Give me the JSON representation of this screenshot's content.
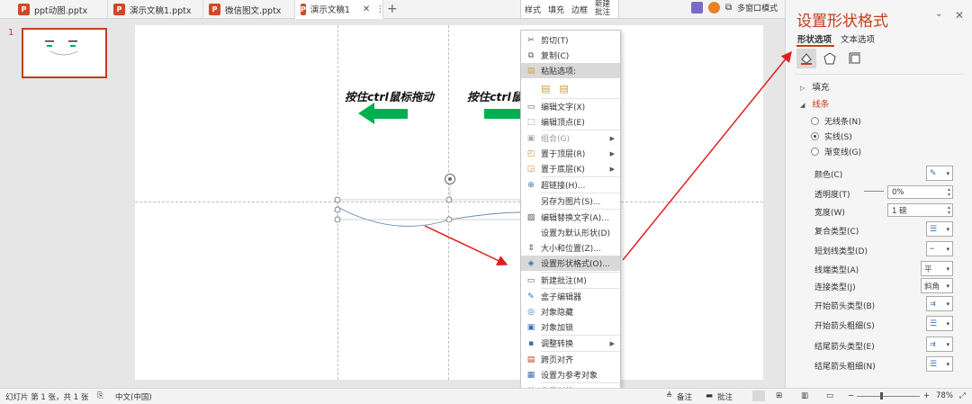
{
  "tabs": [
    {
      "label": "ppt动图.pptx",
      "active": false
    },
    {
      "label": "演示文稿1.pptx",
      "active": false
    },
    {
      "label": "微信图文.pptx",
      "active": false
    },
    {
      "label": "演示文稿1",
      "active": true
    }
  ],
  "mini_toolbar": {
    "style": "样式",
    "fill": "填充",
    "border": "边框",
    "new_comment_line1": "新建",
    "new_comment_line2": "批注"
  },
  "window_mode": "多窗口模式",
  "thumbnail": {
    "number": "1"
  },
  "slide": {
    "text_left": "按住ctrl鼠标拖动",
    "text_right": "按住ctrl鼠"
  },
  "colors": {
    "accent": "#c43e1c",
    "arrow_green": "#00b050",
    "annotation_red": "#e02020",
    "curve": "#6d8eb3"
  },
  "context_menu": {
    "items": [
      {
        "label": "剪切(T)",
        "icon": "scissors-icon"
      },
      {
        "label": "复制(C)",
        "icon": "copy-icon"
      },
      {
        "label": "粘贴选项:",
        "icon": "paste-icon",
        "highlight": true
      },
      {
        "label": "编辑文字(X)",
        "icon": "edit-text-icon"
      },
      {
        "label": "编辑顶点(E)",
        "icon": "edit-points-icon"
      },
      {
        "label": "组合(G)",
        "icon": "group-icon",
        "disabled": true,
        "submenu": true
      },
      {
        "label": "置于顶层(R)",
        "icon": "bring-front-icon",
        "submenu": true
      },
      {
        "label": "置于底层(K)",
        "icon": "send-back-icon",
        "submenu": true
      },
      {
        "label": "超链接(H)...",
        "icon": "hyperlink-icon"
      },
      {
        "label": "另存为图片(S)...",
        "icon": "none"
      },
      {
        "label": "编辑替换文字(A)...",
        "icon": "alt-text-icon"
      },
      {
        "label": "设置为默认形状(D)",
        "icon": "none"
      },
      {
        "label": "大小和位置(Z)...",
        "icon": "size-position-icon"
      },
      {
        "label": "设置形状格式(O)...",
        "icon": "format-shape-icon",
        "highlight": true
      },
      {
        "label": "新建批注(M)",
        "icon": "new-comment-icon"
      },
      {
        "label": "盒子编辑器",
        "icon": "box-editor-icon"
      },
      {
        "label": "对象隐藏",
        "icon": "hide-icon"
      },
      {
        "label": "对象加锁",
        "icon": "lock-icon"
      },
      {
        "label": "调整转换",
        "icon": "convert-icon",
        "submenu": true
      },
      {
        "label": "跨页对齐",
        "icon": "align-pages-icon"
      },
      {
        "label": "设置为参考对象",
        "icon": "reference-icon"
      },
      {
        "label": "收藏形状",
        "icon": "favorite-icon"
      }
    ]
  },
  "panel": {
    "title": "设置形状格式",
    "tab_shape": "形状选项",
    "tab_text": "文本选项",
    "section_fill": "填充",
    "section_line": "线条",
    "radio_none": "无线条(N)",
    "radio_solid": "实线(S)",
    "radio_gradient": "渐变线(G)",
    "color": "颜色(C)",
    "transparency": "透明度(T)",
    "transparency_value": "0%",
    "width": "宽度(W)",
    "width_value": "1 磅",
    "compound": "复合类型(C)",
    "dash": "短划线类型(D)",
    "cap": "线端类型(A)",
    "cap_value": "平",
    "join": "连接类型(J)",
    "join_value": "斜角",
    "begin_arrow_type": "开始箭头类型(B)",
    "begin_arrow_size": "开始箭头粗细(S)",
    "end_arrow_type": "结尾箭头类型(E)",
    "end_arrow_size": "结尾箭头粗细(N)"
  },
  "status": {
    "slide_info": "幻灯片 第 1 张，共 1 张",
    "language": "中文(中国)",
    "notes": "备注",
    "comments": "批注",
    "zoom": "78%"
  }
}
